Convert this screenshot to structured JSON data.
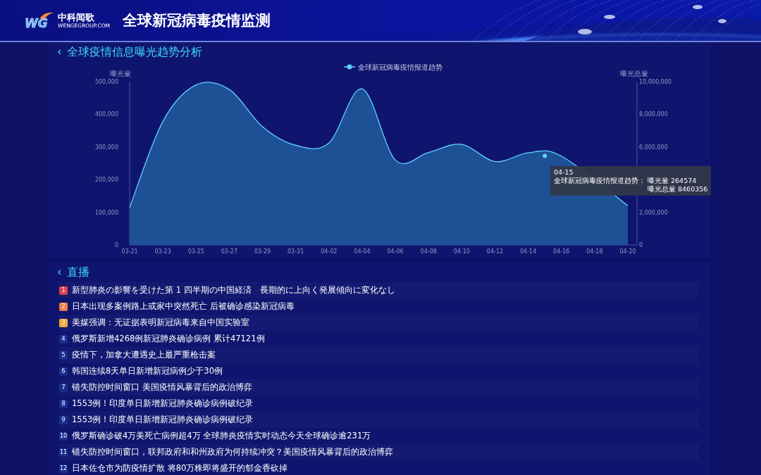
{
  "header": {
    "logo_mark": "WG",
    "logo_name": "中科闻歌",
    "logo_site": "WENGEGROUP.COM",
    "title": "全球新冠病毒疫情监测"
  },
  "trend": {
    "title": "全球疫情信息曝光趋势分析",
    "chart_data": {
      "type": "area",
      "ylabel": "曝光量",
      "y2label": "曝光总量",
      "x": [
        "03-21",
        "03-23",
        "03-25",
        "03-27",
        "03-29",
        "03-31",
        "04-02",
        "04-04",
        "04-06",
        "04-08",
        "04-10",
        "04-12",
        "04-14",
        "04-16",
        "04-18",
        "04-20"
      ],
      "ylim": [
        0,
        500000
      ],
      "y2lim": [
        0,
        10000000
      ],
      "yticks": [
        {
          "value": 0,
          "label": "0"
        },
        {
          "value": 100000,
          "label": "100,000"
        },
        {
          "value": 200000,
          "label": "200,000"
        },
        {
          "value": 300000,
          "label": "300,000"
        },
        {
          "value": 400000,
          "label": "400,000"
        },
        {
          "value": 500000,
          "label": "500,000"
        }
      ],
      "y2ticks": [
        {
          "value": 0,
          "label": "0"
        },
        {
          "value": 2000000,
          "label": "2,000,000"
        },
        {
          "value": 6000000,
          "label": "6,000,000"
        },
        {
          "value": 8000000,
          "label": "8,000,000"
        },
        {
          "value": 10000000,
          "label": "10,000,000"
        }
      ],
      "series": [
        {
          "name": "全球新冠病毒疫情报道趋势",
          "color": "#5fd3ff",
          "values": [
            115000,
            378000,
            490000,
            476000,
            362000,
            305000,
            312000,
            478000,
            260000,
            283000,
            308000,
            255000,
            282000,
            272000,
            null,
            120000
          ]
        }
      ]
    },
    "tooltip": {
      "date": "04-15",
      "series": "全球新冠病毒疫情报道趋势：",
      "value": "曝光量 264574",
      "total": "曝光总量 8460356"
    }
  },
  "live": {
    "title": "直播",
    "items": [
      {
        "rank": "1",
        "color": "#e2414d",
        "title": "新型肺炎の影響を受けた第 1 四半期の中国経済　長期的に上向く発展傾向に変化なし"
      },
      {
        "rank": "2",
        "color": "#ef7d45",
        "title": "日本出现多案例路上或家中突然死亡 后被确诊感染新冠病毒"
      },
      {
        "rank": "3",
        "color": "#f2aa3c",
        "title": "美媒强调：无证据表明新冠病毒来自中国实验室"
      },
      {
        "rank": "4",
        "color": "#1a2f8c",
        "title": "俄罗斯新增4268例新冠肺炎确诊病例 累计47121例"
      },
      {
        "rank": "5",
        "color": "#1a2f8c",
        "title": "疫情下，加拿大遭遇史上最严重枪击案"
      },
      {
        "rank": "6",
        "color": "#1a2f8c",
        "title": "韩国连续8天单日新增新冠病例少于30例"
      },
      {
        "rank": "7",
        "color": "#1a2f8c",
        "title": "错失防控时间窗口 美国疫情风暴背后的政治博弈"
      },
      {
        "rank": "8",
        "color": "#1a2f8c",
        "title": "1553例！印度单日新增新冠肺炎确诊病例破纪录"
      },
      {
        "rank": "9",
        "color": "#1a2f8c",
        "title": "1553例！印度单日新增新冠肺炎确诊病例破纪录"
      },
      {
        "rank": "10",
        "color": "#1a2f8c",
        "title": "俄罗斯确诊破4万美死亡病例超4万 全球肺炎疫情实时动态今天全球确诊逾231万"
      },
      {
        "rank": "11",
        "color": "#1a2f8c",
        "title": "错失防控时间窗口，联邦政府和和州政府为何持续冲突？美国疫情风暴背后的政治博弈"
      },
      {
        "rank": "12",
        "color": "#1a2f8c",
        "title": "日本佐仓市为防疫情扩散 将80万株即将盛开的郁金香砍掉"
      }
    ]
  }
}
